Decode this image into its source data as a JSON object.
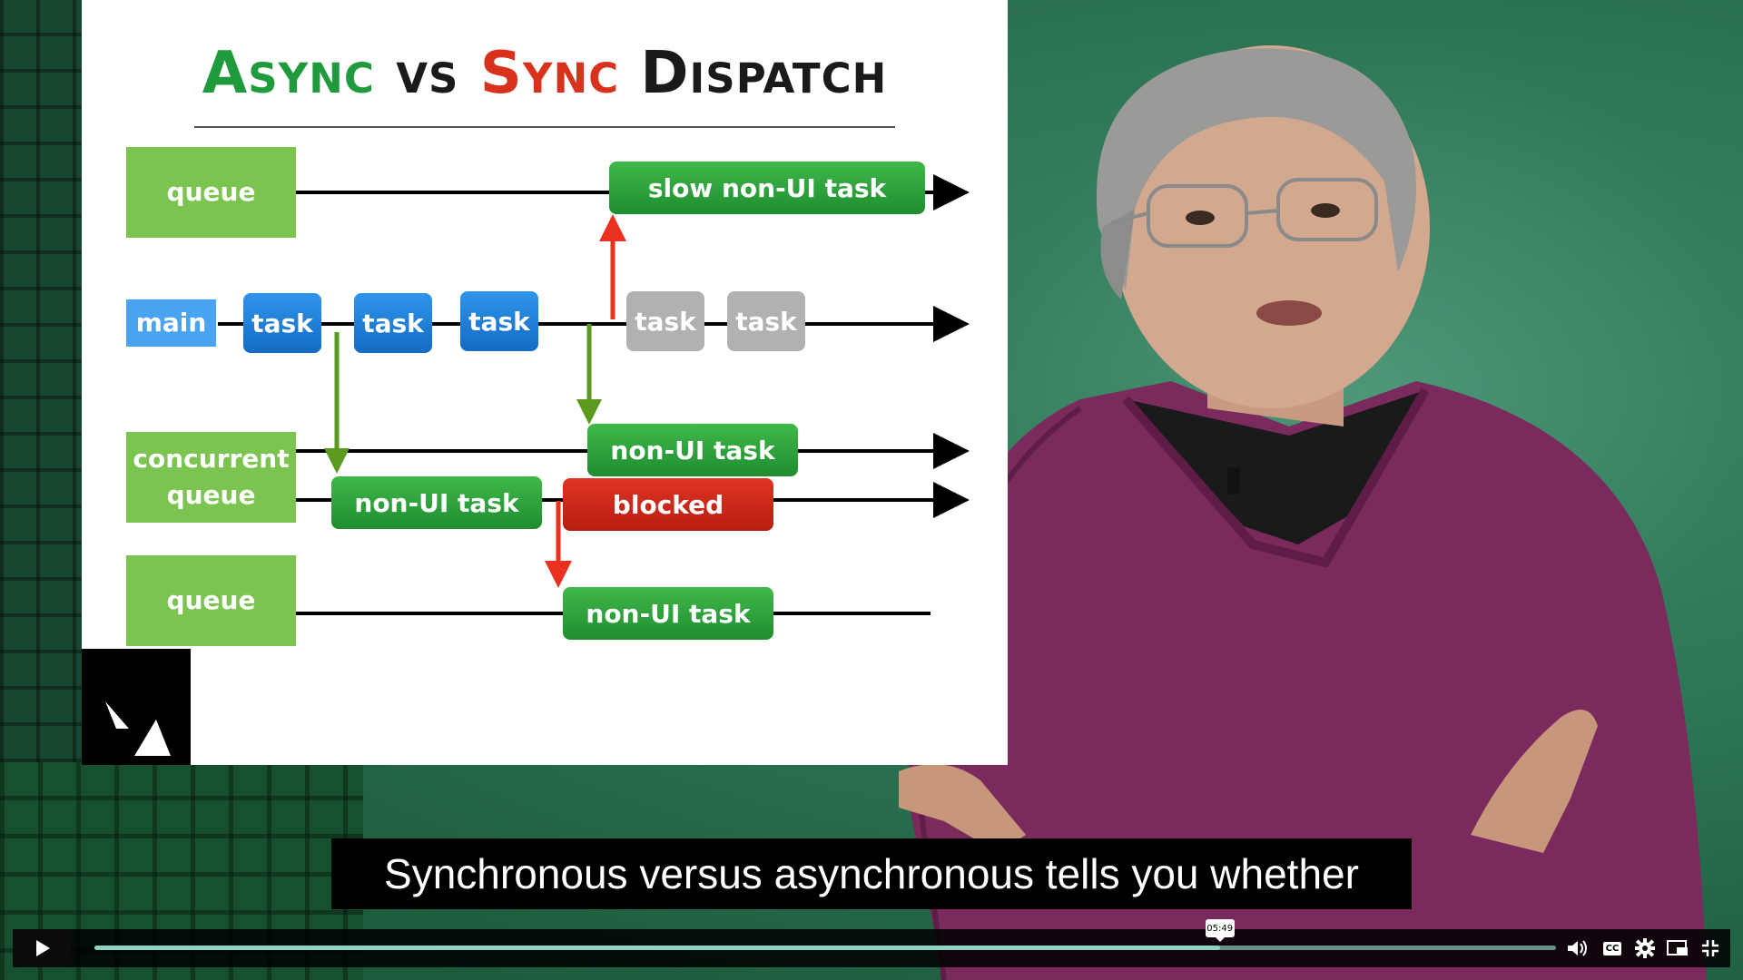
{
  "slide": {
    "title_words": [
      "Async",
      "vs",
      "Sync",
      "Dispatch"
    ],
    "queue_top_label": "queue",
    "main_label": "main",
    "concurrent_label": "concurrent queue",
    "queue_bottom_label": "queue",
    "blue_tasks": [
      "task",
      "task",
      "task"
    ],
    "grey_tasks": [
      "task",
      "task"
    ],
    "slow_task": "slow non-UI task",
    "concurrent_task_upper": "non-UI task",
    "concurrent_task_lower": "non-UI task",
    "blocked_label": "blocked",
    "queue_bottom_task": "non-UI task",
    "colors": {
      "green_box": "#7cc450",
      "main_box": "#4aa3f0",
      "green_arrow": "#5b9a1f",
      "red_arrow": "#e8321f",
      "title_green": "#1f9a3d",
      "title_red": "#d8311c"
    }
  },
  "caption": {
    "text": "Synchronous versus asynchronous tells you whether"
  },
  "player": {
    "time_tooltip": "05:49",
    "progress": 0.77,
    "icons": [
      "play-icon",
      "volume-icon",
      "closed-captions-icon",
      "settings-gear-icon",
      "picture-in-picture-icon",
      "exit-fullscreen-icon"
    ],
    "cc_label": "CC"
  }
}
